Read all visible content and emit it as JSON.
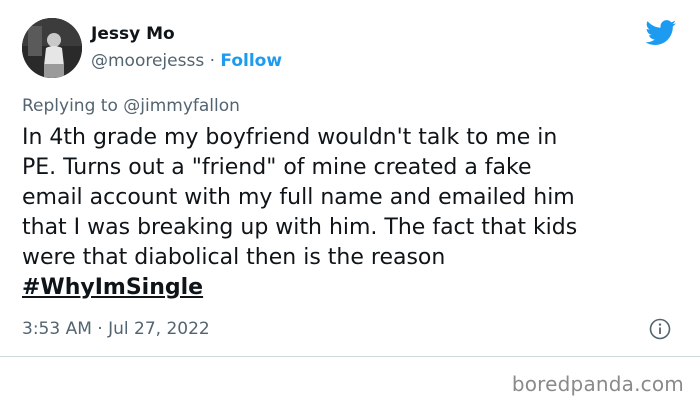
{
  "author": {
    "name": "Jessy Mo",
    "handle": "@moorejesss",
    "separator": "·",
    "follow_label": "Follow"
  },
  "reply": {
    "prefix": "Replying to",
    "target": "@jimmyfallon"
  },
  "tweet": {
    "lines": [
      "In 4th grade my boyfriend wouldn't talk to me in",
      "PE. Turns out a \"friend\" of mine created a fake",
      "email account with my full name and emailed him",
      "that I was breaking up with him. The fact that kids",
      "were that diabolical then is the reason"
    ],
    "hashtag": "#WhyImSingle"
  },
  "timestamp": "3:53 AM · Jul 27, 2022",
  "watermark": "boredpanda.com",
  "icons": {
    "platform": "twitter-bird-icon",
    "info": "info-icon"
  },
  "colors": {
    "brand": "#1d9bf0",
    "secondary_text": "#536471",
    "primary_text": "#0f1419"
  }
}
